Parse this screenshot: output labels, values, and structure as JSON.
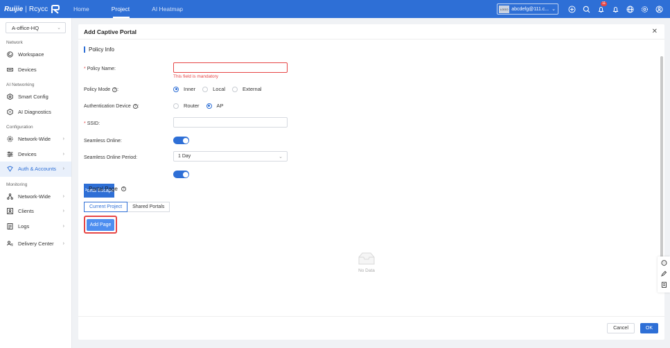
{
  "header": {
    "brand": "Ruijie",
    "sub_brand": "Rcycc",
    "nav": [
      "Home",
      "Project",
      "AI Heatmap"
    ],
    "account_badge": "LOGO",
    "account": "abcdefg@111.c...",
    "notification_count": "11"
  },
  "sidebar": {
    "site": "A-office-HQ",
    "groups": {
      "network": "Network",
      "ai": "AI Networking",
      "config": "Configuration",
      "monitoring": "Monitoring"
    },
    "items": {
      "workspace": "Workspace",
      "devices": "Devices",
      "smart_config": "Smart Config",
      "ai_diagnostics": "AI Diagnostics",
      "network_wide": "Network-Wide",
      "config_devices": "Devices",
      "auth_accounts": "Auth & Accounts",
      "mon_network_wide": "Network-Wide",
      "clients": "Clients",
      "logs": "Logs",
      "delivery_center": "Delivery Center"
    }
  },
  "dialog": {
    "title": "Add Captive Portal",
    "policy_info": "Policy Info",
    "policy_name_label": "Policy Name",
    "policy_name_value": "",
    "policy_name_error": "This field is mandatory",
    "policy_mode_label": "Policy Mode",
    "policy_mode_options": [
      "Inner",
      "Local",
      "External"
    ],
    "policy_mode_selected": "Inner",
    "auth_device_label": "Authentication Device",
    "auth_device_options": [
      "Router",
      "AP"
    ],
    "auth_device_selected": "AP",
    "ssid_label": "SSID",
    "ssid_value": "",
    "seamless_online_label": "Seamless Online",
    "seamless_online_enabled": true,
    "seamless_period_label": "Seamless Online Period",
    "seamless_period_value": "1 Day",
    "portal_escape_label": "Portal Escape",
    "portal_escape_enabled": true,
    "portal_page_title": "Portal Page",
    "tabs": [
      "Current Project",
      "Shared Portals"
    ],
    "add_page": "Add Page",
    "empty_text": "No Data",
    "cancel": "Cancel",
    "ok": "OK"
  },
  "colors": {
    "primary": "#2e6fd6",
    "error": "#e64545",
    "sidebar_active_bg": "#e9f0fb"
  }
}
